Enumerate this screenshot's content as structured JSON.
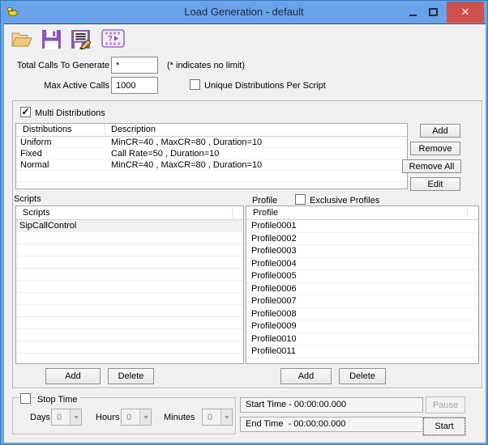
{
  "window": {
    "title": "Load Generation - default"
  },
  "glyphs": {
    "check": "✓",
    "close": "✕"
  },
  "toolbar": {
    "icons": [
      "open-file",
      "save",
      "save-as",
      "test-video-help"
    ]
  },
  "fields": {
    "total_calls_label": "Total Calls To Generate",
    "total_calls_value": "*",
    "no_limit_hint": "(* indicates no limit)",
    "max_active_label": "Max Active Calls",
    "max_active_value": "1000",
    "unique_dist_label": "Unique Distributions Per Script"
  },
  "distributions": {
    "checkbox_label": "Multi Distributions",
    "checked": true,
    "columns": [
      "Distributions",
      "Description"
    ],
    "rows": [
      {
        "name": "Uniform",
        "description": "MinCR=40 , MaxCR=80 , Duration=10"
      },
      {
        "name": "Fixed",
        "description": "Call Rate=50 , Duration=10"
      },
      {
        "name": "Normal",
        "description": "MinCR=40 , MaxCR=80 , Duration=10"
      }
    ],
    "buttons": {
      "add": "Add",
      "remove": "Remove",
      "remove_all": "Remove All",
      "edit": "Edit"
    }
  },
  "scripts": {
    "section_label": "Scripts",
    "column_header": "Scripts",
    "items": [
      "SipCallControl"
    ],
    "add_label": "Add",
    "delete_label": "Delete"
  },
  "profiles": {
    "section_label": "Profile",
    "exclusive_label": "Exclusive Profiles",
    "exclusive_checked": false,
    "column_header": "Profile",
    "items": [
      "Profile0001",
      "Profile0002",
      "Profile0003",
      "Profile0004",
      "Profile0005",
      "Profile0006",
      "Profile0007",
      "Profile0008",
      "Profile0009",
      "Profile0010",
      "Profile0011"
    ],
    "add_label": "Add",
    "delete_label": "Delete"
  },
  "stop_time": {
    "label": "Stop Time",
    "checked": false,
    "days_label": "Days",
    "days_value": "0",
    "hours_label": "Hours",
    "hours_value": "0",
    "minutes_label": "Minutes",
    "minutes_value": "0"
  },
  "times": {
    "start": "Start Time - 00:00:00.000",
    "end": "End Time  - 00:00:00.000"
  },
  "actions": {
    "pause": "Pause",
    "start": "Start"
  },
  "colors": {
    "titlebar": "#6ba3e9",
    "close_button": "#ce524b",
    "icon_purple": "#8a57ae",
    "folder_tan": "#eec97f",
    "background": "#f0f0f0",
    "selected_row": "#eef1ee"
  }
}
